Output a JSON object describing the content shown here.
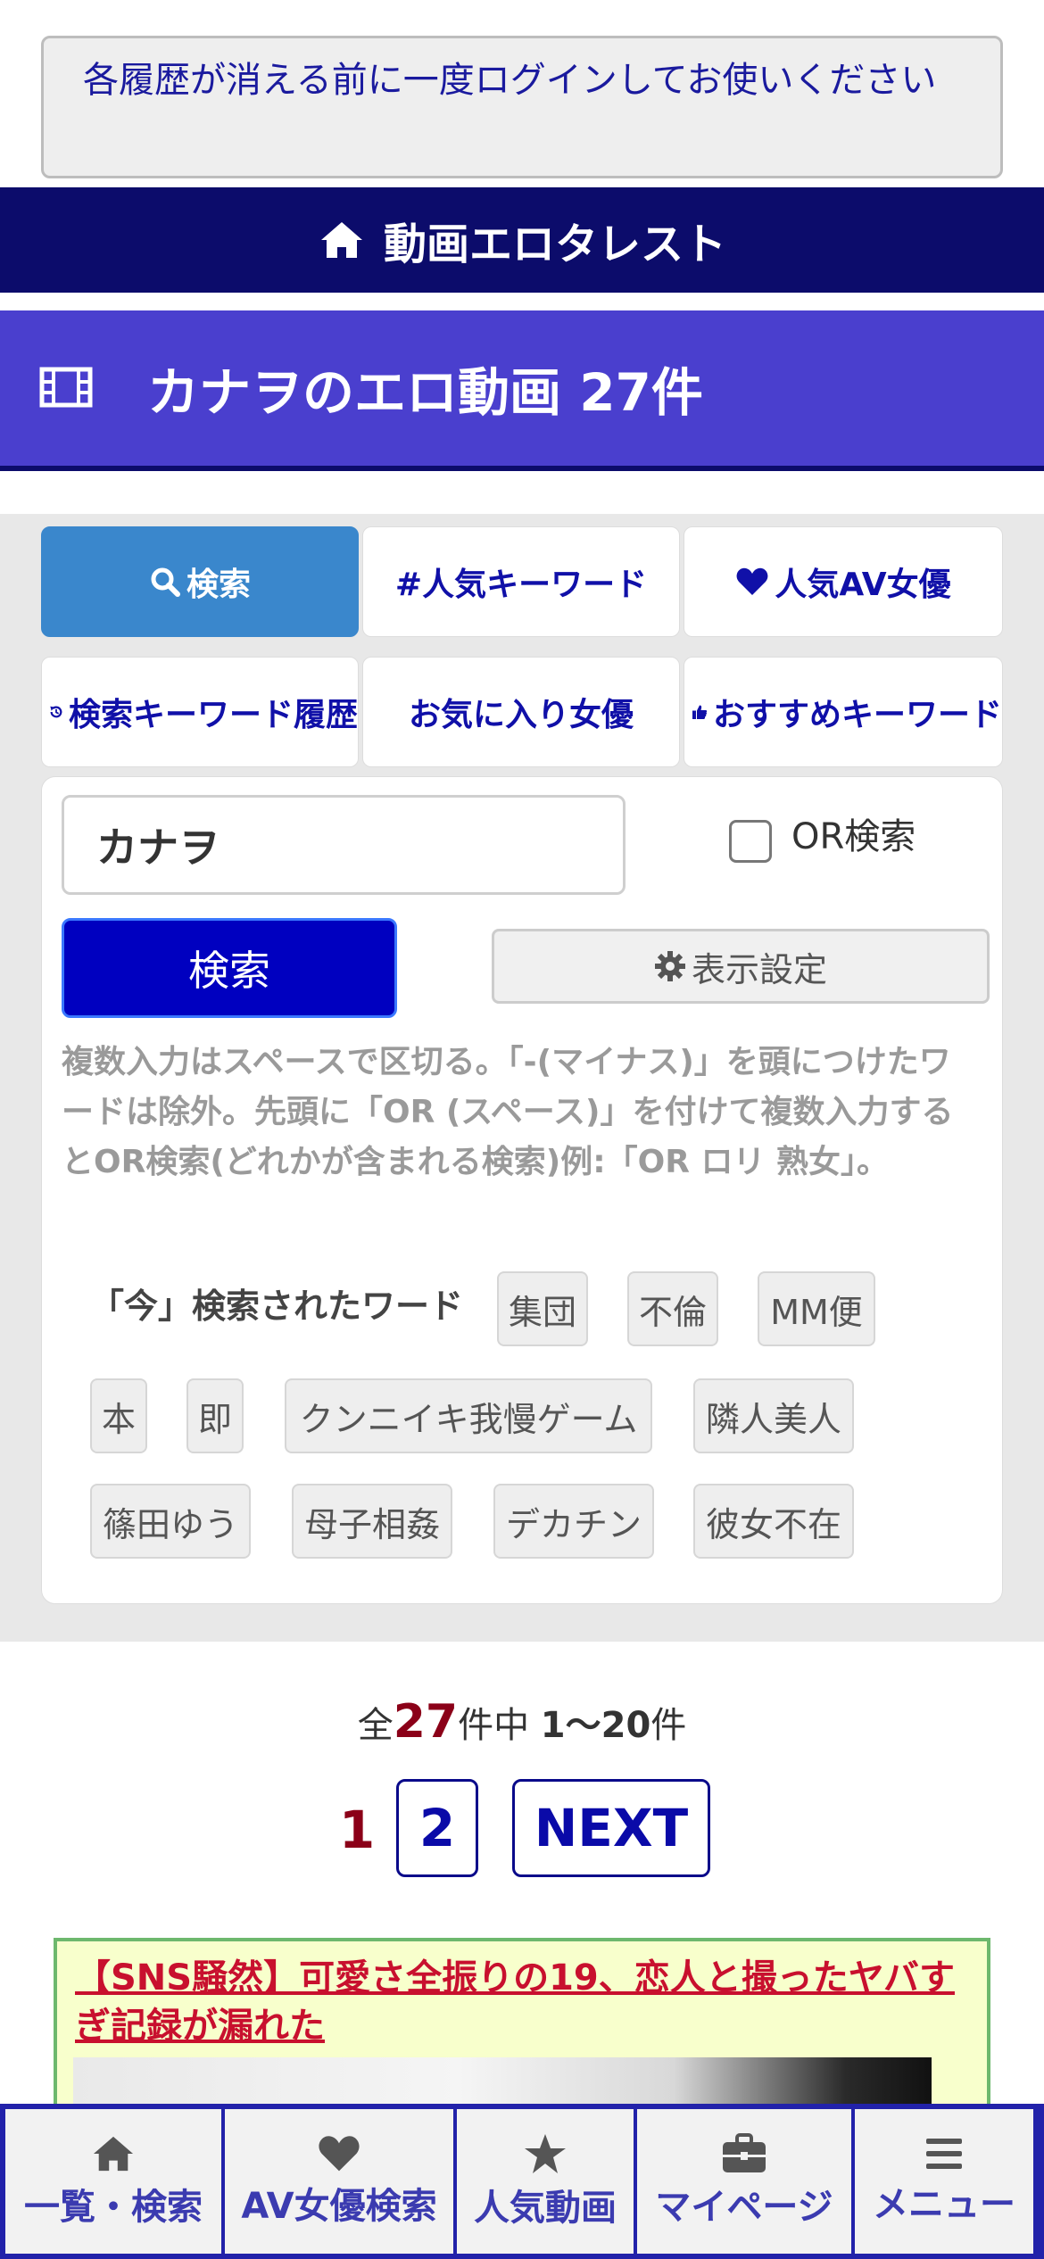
{
  "notice": {
    "text": "各履歴が消える前に一度ログインしてお使いください"
  },
  "header": {
    "title": "動画エロタレスト"
  },
  "page_title": "カナヲのエロ動画 27件",
  "tabs": [
    {
      "label": "検索"
    },
    {
      "label": "#人気キーワード"
    },
    {
      "label": "人気AV女優"
    },
    {
      "label": "検索キーワード履歴"
    },
    {
      "label": "お気に入り女優"
    },
    {
      "label": "おすすめキーワード"
    }
  ],
  "search": {
    "value": "カナヲ",
    "or_label": "OR検索",
    "button_label": "検索",
    "settings_label": "表示設定",
    "help": "複数入力はスペースで区切る。「-(マイナス)」を頭につけたワードは除外。先頭に「OR (スペース)」を付けて複数入力するとOR検索(どれかが含まれる検索)例:「OR ロリ 熟女」。"
  },
  "trending": {
    "label": "「今」検索されたワード",
    "keywords": [
      "集団",
      "不倫",
      "MM便",
      "本",
      "即",
      "クンニイキ我慢ゲーム",
      "隣人美人",
      "篠田ゆう",
      "母子相姦",
      "デカチン",
      "彼女不在"
    ]
  },
  "results": {
    "prefix": "全",
    "total": "27",
    "middle": "件中",
    "range": "1〜20",
    "suffix": "件"
  },
  "pager": {
    "current": "1",
    "page2": "2",
    "next": "NEXT"
  },
  "ad": {
    "title": "【SNS騒然】可愛さ全振りの19、恋人と撮ったヤバすぎ記録が漏れた"
  },
  "bottom_nav": [
    {
      "label": "一覧・検索",
      "icon": "home-icon"
    },
    {
      "label": "AV女優検索",
      "icon": "heart-icon"
    },
    {
      "label": "人気動画",
      "icon": "star-icon"
    },
    {
      "label": "マイページ",
      "icon": "briefcase-icon"
    },
    {
      "label": "メニュー",
      "icon": "menu-icon"
    }
  ],
  "colors": {
    "header": "#0c0c6b",
    "title_band": "#4a3fce",
    "tab_active": "#3a87cc",
    "search_button": "#0000c0",
    "accent_red": "#8b0018"
  }
}
